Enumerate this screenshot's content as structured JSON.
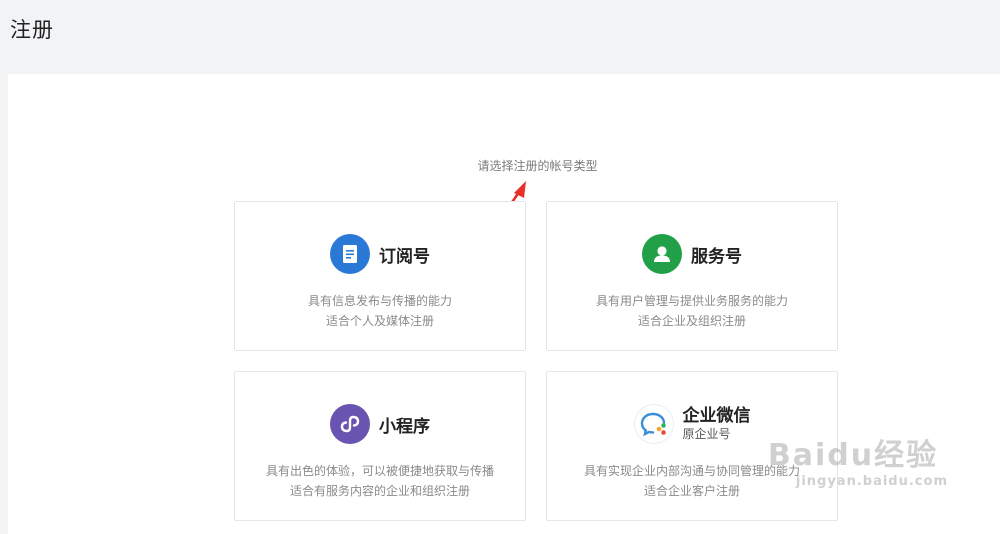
{
  "page": {
    "title": "注册"
  },
  "register": {
    "prompt": "请选择注册的帐号类型",
    "cards": [
      {
        "name": "订阅号",
        "icon": "document-icon",
        "color": "#2b79d6",
        "desc_line1": "具有信息发布与传播的能力",
        "desc_line2": "适合个人及媒体注册"
      },
      {
        "name": "服务号",
        "icon": "user-icon",
        "color": "#21a048",
        "desc_line1": "具有用户管理与提供业务服务的能力",
        "desc_line2": "适合企业及组织注册"
      },
      {
        "name": "小程序",
        "icon": "miniprogram-icon",
        "color": "#6955b1",
        "desc_line1": "具有出色的体验，可以被便捷地获取与传播",
        "desc_line2": "适合有服务内容的企业和组织注册"
      },
      {
        "name": "企业微信",
        "subname": "原企业号",
        "icon": "wework-icon",
        "color": "#3a8fd8",
        "desc_line1": "具有实现企业内部沟通与协同管理的能力",
        "desc_line2": "适合企业客户注册"
      }
    ]
  },
  "watermark": {
    "logo": "Baidu经验",
    "url": "jingyan.baidu.com"
  }
}
